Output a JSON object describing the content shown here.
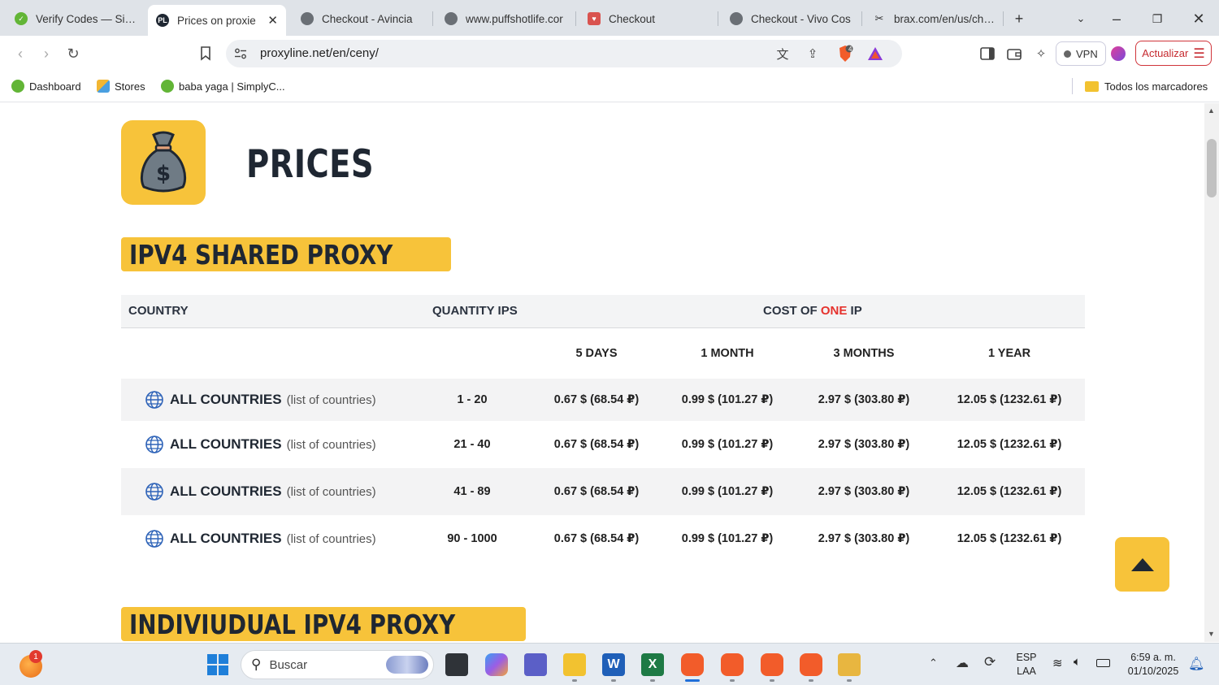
{
  "browser": {
    "tabs": [
      {
        "title": "Verify Codes — Simp",
        "active": false
      },
      {
        "title": "Prices on proxie",
        "active": true,
        "favicon_text": "PL"
      },
      {
        "title": "Checkout - Avincia",
        "active": false
      },
      {
        "title": "www.puffshotlife.cor",
        "active": false
      },
      {
        "title": "Checkout",
        "active": false
      },
      {
        "title": "Checkout - Vivo Cos",
        "active": false
      },
      {
        "title": "brax.com/en/us/chec",
        "active": false
      }
    ],
    "url": "proxyline.net/en/ceny/",
    "shield_count": "4",
    "vpn_label": "VPN",
    "update_label": "Actualizar",
    "bookmarks": [
      {
        "label": "Dashboard"
      },
      {
        "label": "Stores"
      },
      {
        "label": "baba yaga | SimplyC..."
      }
    ],
    "all_bookmarks_label": "Todos los marcadores"
  },
  "page": {
    "title": "PRICES",
    "section1": "IPV4 SHARED PROXY",
    "section2": "INDIVIUDUAL IPV4 PROXY",
    "table": {
      "col_country": "COUNTRY",
      "col_quantity": "QUANTITY IPS",
      "col_cost_prefix": "COST OF ",
      "col_cost_accent": "ONE",
      "col_cost_suffix": " IP",
      "periods": [
        "5 DAYS",
        "1 MONTH",
        "3 MONTHS",
        "1 YEAR"
      ],
      "accent_color": "#e5322d",
      "rows": [
        {
          "country": "ALL COUNTRIES",
          "link": "(list of countries)",
          "quantity": "1 - 20",
          "prices": [
            "0.67 $ (68.54 ₽)",
            "0.99 $ (101.27 ₽)",
            "2.97 $ (303.80 ₽)",
            "12.05 $ (1232.61 ₽)"
          ]
        },
        {
          "country": "ALL COUNTRIES",
          "link": "(list of countries)",
          "quantity": "21 - 40",
          "prices": [
            "0.67 $ (68.54 ₽)",
            "0.99 $ (101.27 ₽)",
            "2.97 $ (303.80 ₽)",
            "12.05 $ (1232.61 ₽)"
          ]
        },
        {
          "country": "ALL COUNTRIES",
          "link": "(list of countries)",
          "quantity": "41 - 89",
          "prices": [
            "0.67 $ (68.54 ₽)",
            "0.99 $ (101.27 ₽)",
            "2.97 $ (303.80 ₽)",
            "12.05 $ (1232.61 ₽)"
          ]
        },
        {
          "country": "ALL COUNTRIES",
          "link": "(list of countries)",
          "quantity": "90 - 1000",
          "prices": [
            "0.67 $ (68.54 ₽)",
            "0.99 $ (101.27 ₽)",
            "2.97 $ (303.80 ₽)",
            "12.05 $ (1232.61 ₽)"
          ]
        }
      ]
    },
    "brand_color": "#f7c33a"
  },
  "taskbar": {
    "notification_count": "1",
    "search_placeholder": "Buscar",
    "language": "ESP",
    "layout": "LAA",
    "time": "6:59 a. m.",
    "date": "01/10/2025"
  }
}
